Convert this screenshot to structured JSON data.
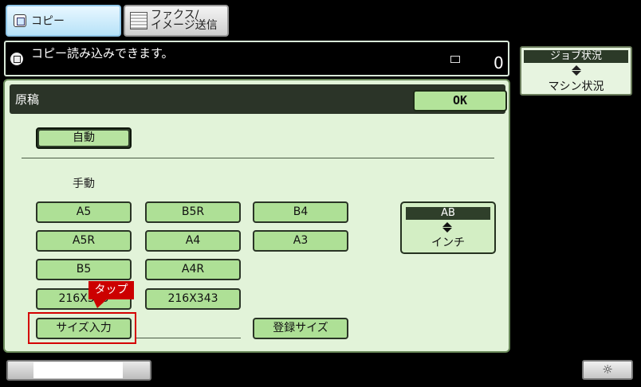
{
  "tabs": {
    "copy_label": "コピー",
    "fax_line1": "ファクス/",
    "fax_line2": "イメージ送信"
  },
  "message": {
    "text": "コピー読み込みできます。",
    "job_count": "0"
  },
  "job_status": {
    "top_label": "ジョブ状況",
    "bottom_label": "マシン状況"
  },
  "panel": {
    "title": "原稿",
    "ok_label": "OK",
    "auto_label": "自動",
    "manual_label": "手動",
    "sizes": {
      "a5": "A5",
      "b5r": "B5R",
      "b4": "B4",
      "a5r": "A5R",
      "a4": "A4",
      "a3": "A3",
      "b5": "B5",
      "a4r": "A4R",
      "s216x330": "216X330",
      "s216x343": "216X343"
    },
    "size_input_label": "サイズ入力",
    "registered_size_label": "登録サイズ",
    "unit_top": "AB",
    "unit_bottom": "インチ"
  },
  "callout": {
    "tap_label": "タップ"
  },
  "bottom": {
    "brightness_icon": "sun-icon",
    "brightness_glyph": "☼"
  },
  "colors": {
    "panel_bg": "#e2f3d9",
    "button_green": "#aee096",
    "highlight_red": "#d40000"
  }
}
